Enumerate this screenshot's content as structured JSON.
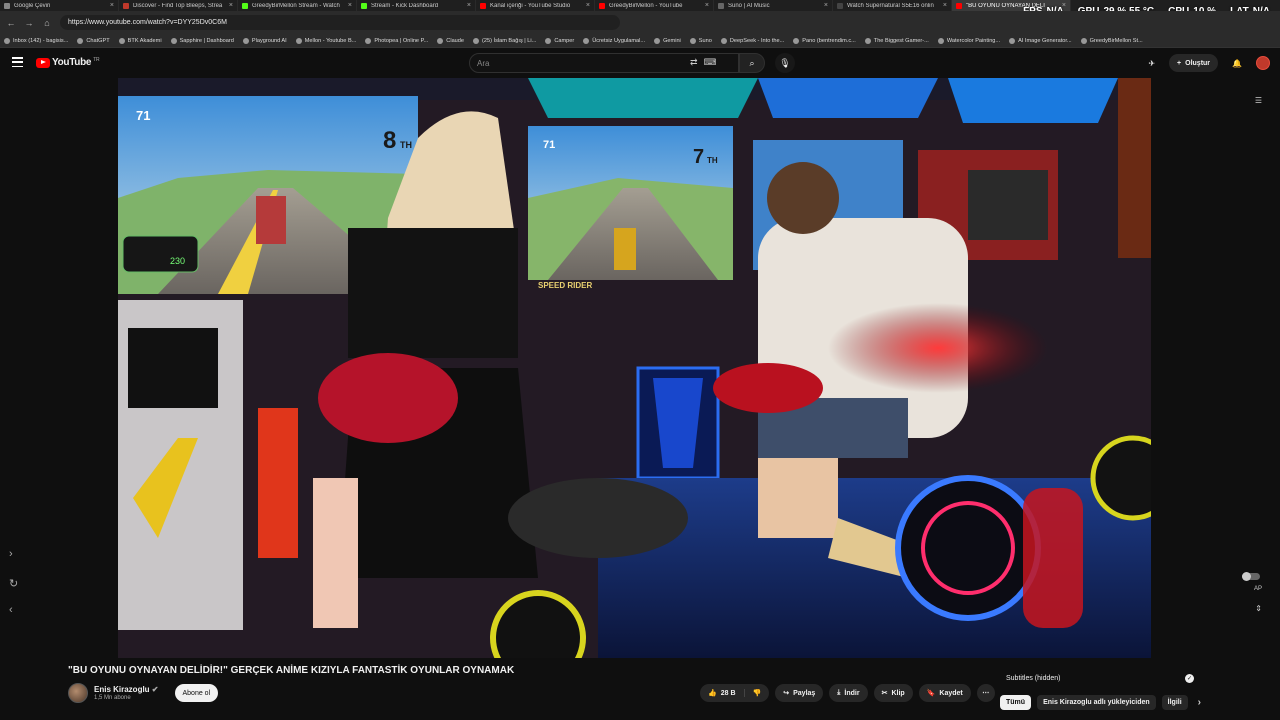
{
  "tabs": [
    {
      "title": "Google Çeviri",
      "active": false
    },
    {
      "title": "Discover - Find Top Bleeps, Strea",
      "active": false
    },
    {
      "title": "GreedyBirMellon Stream - Watch",
      "active": false
    },
    {
      "title": "Stream - Kick Dashboard",
      "active": false
    },
    {
      "title": "Kanal içeriği - YouTube Studio",
      "active": false
    },
    {
      "title": "GreedyBirMellon - YouTube",
      "active": false
    },
    {
      "title": "Suno | AI Music",
      "active": false
    },
    {
      "title": "Watch Supernatural S5E16 onlin",
      "active": false
    },
    {
      "title": "\"BU OYUNU OYNAYAN DELİ",
      "active": true
    }
  ],
  "url": "https://www.youtube.com/watch?v=DYY25Dv0C6M",
  "bookmarks": [
    "Inbox (142) - bagisis...",
    "ChatGPT",
    "BTK Akademi",
    "Sapphire | Dashboard",
    "Playground AI",
    "Mellon - Youtube B...",
    "Photopea | Online P...",
    "Claude",
    "(25) İslam Bağış | Li...",
    "Camper",
    "Ücretsiz Uygulamal...",
    "Gemini",
    "Suno",
    "DeepSeek - Into the...",
    "Pano (bentrendim.c...",
    "The Biggest Gamer-...",
    "Watercolor Painting...",
    "AI Image Generator...",
    "GreedyBirMellon St..."
  ],
  "overlay": {
    "fps_label": "FPS",
    "fps": "N/A",
    "gpu_label": "GPU",
    "gpu": "29 % 55 °C",
    "cpu_label": "CPU",
    "cpu": "10 %",
    "lat_label": "LAT",
    "lat": "N/A"
  },
  "header": {
    "logo": "YouTube",
    "logo_region": "TR",
    "search_placeholder": "Ara",
    "create_label": "Oluştur"
  },
  "video": {
    "title": "\"BU OYUNU OYNAYAN DELİDİR!\" GERÇEK ANİME KIZIYLA FANTASTİK OYUNLAR OYNAMAK",
    "hud_left_place": "8",
    "hud_left_suffix": "TH",
    "hud_left_speed": "230",
    "hud_left_lap": "71",
    "hud_right_place": "7",
    "hud_right_suffix": "TH",
    "hud_right_lap": "71",
    "brand": "SPEED RIDER"
  },
  "channel": {
    "name": "Enis Kirazoglu",
    "subscribers": "1,5 Mn abone",
    "subscribe_label": "Abone ol"
  },
  "actions": {
    "likes": "28 B",
    "share": "Paylaş",
    "download": "İndir",
    "clip": "Klip",
    "save": "Kaydet"
  },
  "side": {
    "ap_label": "AP"
  },
  "subtitles_label": "Subtitles (hidden)",
  "chips": [
    "Tümü",
    "Enis Kirazoglu adlı yükleyiciden",
    "İlgili"
  ],
  "colors": {
    "accent": "#ff0000",
    "background": "#0f0f0f"
  }
}
